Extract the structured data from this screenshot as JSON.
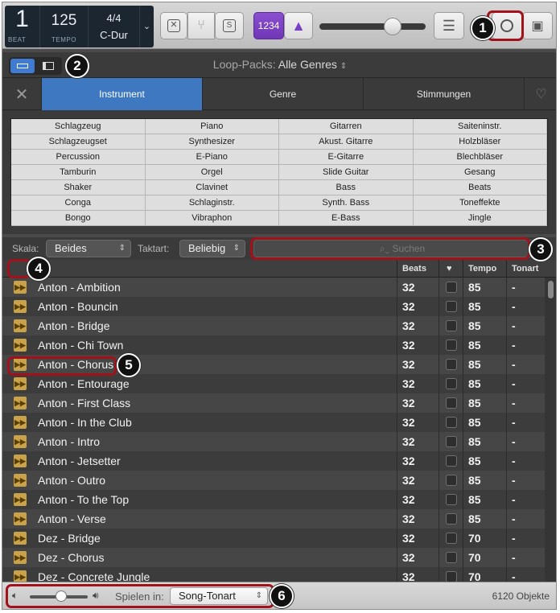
{
  "lcd": {
    "beat_value": "1",
    "beat_caption": "BEAT",
    "tempo_value": "125",
    "tempo_caption": "TEMPO",
    "time_signature": "4/4",
    "key": "C-Dur"
  },
  "toolbar": {
    "count_in_label": "1234",
    "solo_label": "S"
  },
  "loop_browser": {
    "packs_label": "Loop-Packs:",
    "packs_value": "Alle Genres"
  },
  "tabs": [
    "Instrument",
    "Genre",
    "Stimmungen"
  ],
  "keywords": [
    [
      "Schlagzeug",
      "Piano",
      "Gitarren",
      "Saiteninstr."
    ],
    [
      "Schlagzeugset",
      "Synthesizer",
      "Akust. Gitarre",
      "Holzbläser"
    ],
    [
      "Percussion",
      "E-Piano",
      "E-Gitarre",
      "Blechbläser"
    ],
    [
      "Tamburin",
      "Orgel",
      "Slide Guitar",
      "Gesang"
    ],
    [
      "Shaker",
      "Clavinet",
      "Bass",
      "Beats"
    ],
    [
      "Conga",
      "Schlaginstr.",
      "Synth. Bass",
      "Toneffekte"
    ],
    [
      "Bongo",
      "Vibraphon",
      "E-Bass",
      "Jingle"
    ]
  ],
  "filters": {
    "scale_label": "Skala:",
    "scale_value": "Beides",
    "signature_label": "Taktart:",
    "signature_value": "Beliebig",
    "search_placeholder": "Suchen"
  },
  "table": {
    "headers": {
      "beats": "Beats",
      "fav": "♥",
      "tempo": "Tempo",
      "key": "Tonart"
    },
    "rows": [
      {
        "name": "Anton - Ambition",
        "beats": "32",
        "tempo": "85",
        "key": "-"
      },
      {
        "name": "Anton - Bouncin",
        "beats": "32",
        "tempo": "85",
        "key": "-"
      },
      {
        "name": "Anton - Bridge",
        "beats": "32",
        "tempo": "85",
        "key": "-"
      },
      {
        "name": "Anton - Chi Town",
        "beats": "32",
        "tempo": "85",
        "key": "-"
      },
      {
        "name": "Anton - Chorus",
        "beats": "32",
        "tempo": "85",
        "key": "-"
      },
      {
        "name": "Anton - Entourage",
        "beats": "32",
        "tempo": "85",
        "key": "-"
      },
      {
        "name": "Anton - First Class",
        "beats": "32",
        "tempo": "85",
        "key": "-"
      },
      {
        "name": "Anton - In the Club",
        "beats": "32",
        "tempo": "85",
        "key": "-"
      },
      {
        "name": "Anton - Intro",
        "beats": "32",
        "tempo": "85",
        "key": "-"
      },
      {
        "name": "Anton - Jetsetter",
        "beats": "32",
        "tempo": "85",
        "key": "-"
      },
      {
        "name": "Anton - Outro",
        "beats": "32",
        "tempo": "85",
        "key": "-"
      },
      {
        "name": "Anton - To the Top",
        "beats": "32",
        "tempo": "85",
        "key": "-"
      },
      {
        "name": "Anton - Verse",
        "beats": "32",
        "tempo": "85",
        "key": "-"
      },
      {
        "name": "Dez - Bridge",
        "beats": "32",
        "tempo": "70",
        "key": "-"
      },
      {
        "name": "Dez - Chorus",
        "beats": "32",
        "tempo": "70",
        "key": "-"
      },
      {
        "name": "Dez - Concrete Jungle",
        "beats": "32",
        "tempo": "70",
        "key": "-"
      }
    ]
  },
  "footer": {
    "play_in_label": "Spielen in:",
    "play_in_value": "Song-Tonart",
    "object_count": "6120 Objekte"
  },
  "callouts": [
    "1",
    "2",
    "3",
    "4",
    "5",
    "6"
  ]
}
